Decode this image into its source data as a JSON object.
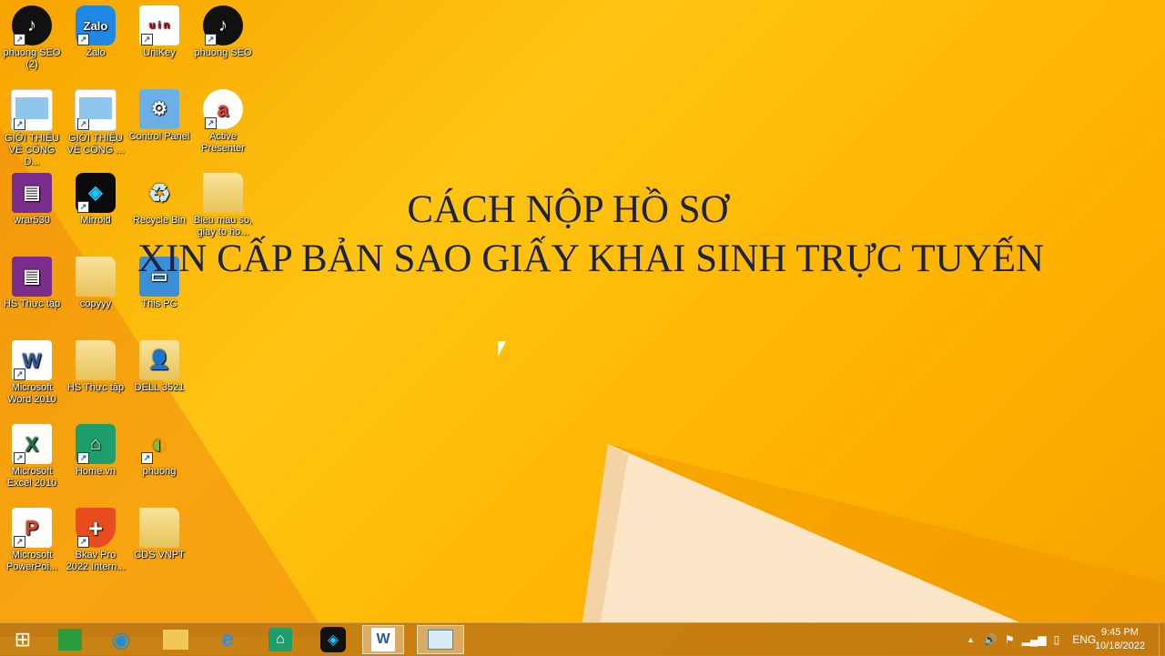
{
  "desktop": {
    "icons": [
      {
        "label": "phuong SEO (2)"
      },
      {
        "label": "Zalo"
      },
      {
        "label": "UniKey"
      },
      {
        "label": "phuong SEO"
      },
      {
        "label": "GIỚI THIỆU VỀ CÔNG D..."
      },
      {
        "label": "GIỚI THIỆU VỀ CÔNG ..."
      },
      {
        "label": "Control Panel"
      },
      {
        "label": "Active Presenter"
      },
      {
        "label": "wrar530"
      },
      {
        "label": "Mirroid"
      },
      {
        "label": "Recycle Bin"
      },
      {
        "label": "Bieu mau so, giay to ho..."
      },
      {
        "label": "HS Thực tập"
      },
      {
        "label": "copyyy"
      },
      {
        "label": "This PC"
      },
      {
        "label": "Microsoft Word 2010"
      },
      {
        "label": "HS Thực tập"
      },
      {
        "label": "DELL 3521"
      },
      {
        "label": "Microsoft Excel 2010"
      },
      {
        "label": "Home.vn"
      },
      {
        "label": "phuong"
      },
      {
        "label": "Microsoft PowerPoi..."
      },
      {
        "label": "Bkav Pro 2022 Intern..."
      },
      {
        "label": "CDS VNPT"
      }
    ],
    "glyphs": {
      "zalo": "Zalo",
      "unikey": "u i n",
      "word": "W",
      "excel": "X",
      "ppt": "P",
      "active": "a",
      "bkav": "+",
      "tiktok": "♪"
    }
  },
  "overlay": {
    "line1": "CÁCH NỘP HỒ SƠ",
    "line2": "XIN CẤP BẢN SAO GIẤY KHAI SINH TRỰC TUYẾN"
  },
  "taskbar": {
    "tray": {
      "language": "ENG"
    },
    "clock": {
      "time": "9:45 PM",
      "date": "10/18/2022"
    }
  },
  "colors": {
    "wallpaper": "#ffc412",
    "title_text": "#1d2340",
    "taskbar": "#b46e14"
  }
}
